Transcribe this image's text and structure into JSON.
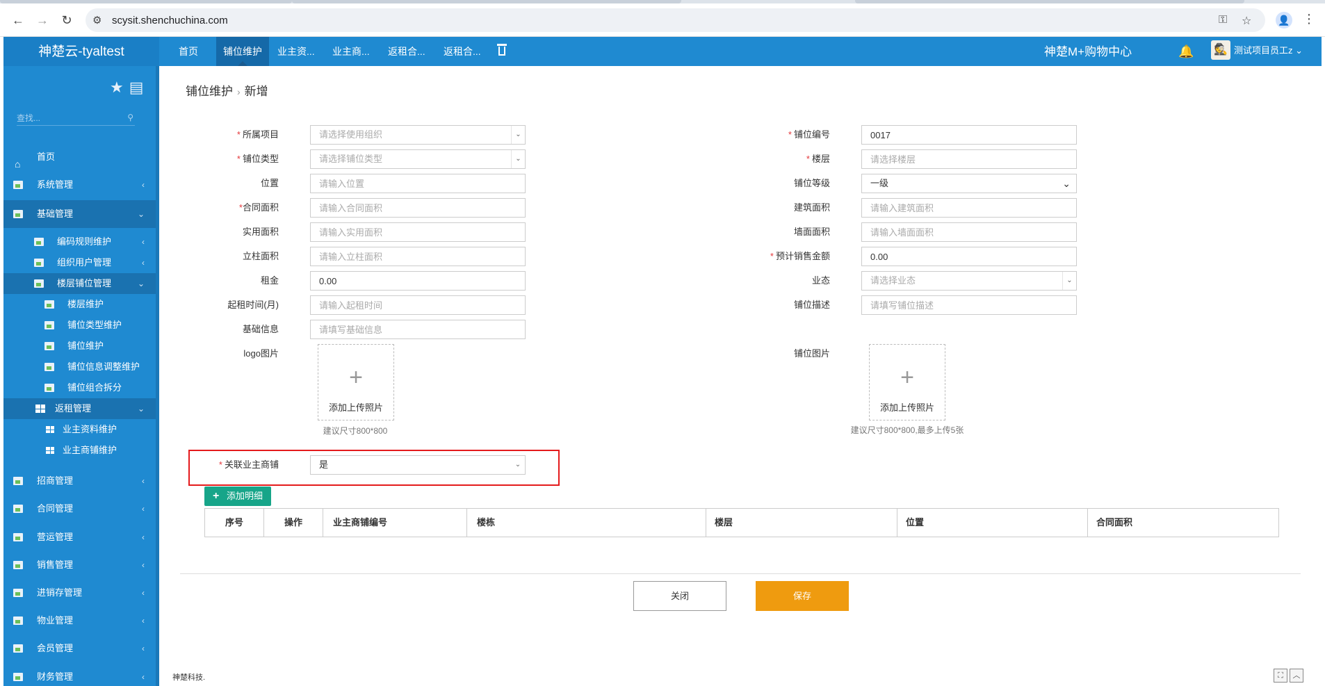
{
  "browser": {
    "url": "scysit.shenchuchina.com",
    "back_icon": "←",
    "forward_icon": "→",
    "reload_icon": "↻",
    "site_icon": "⚙",
    "key_icon": "⚿",
    "star_icon": "☆",
    "profile_icon": "👤",
    "menu_icon": "⋮"
  },
  "header": {
    "brand": "神楚云-tyaltest",
    "tabs": [
      {
        "label": "首页"
      },
      {
        "label": "铺位维护"
      },
      {
        "label": "业主资..."
      },
      {
        "label": "业主商..."
      },
      {
        "label": "返租合..."
      },
      {
        "label": "返租合..."
      }
    ],
    "mall_name": "神楚M+购物中心",
    "user_name": "测试项目员工z ⌄",
    "avatar": "🕵"
  },
  "sidebar": {
    "search_placeholder": "查找...",
    "items": [
      {
        "label": "首页"
      },
      {
        "label": "系统管理"
      },
      {
        "label": "基础管理"
      },
      {
        "label": "编码规则维护"
      },
      {
        "label": "组织用户管理"
      },
      {
        "label": "楼层铺位管理"
      },
      {
        "label": "楼层维护"
      },
      {
        "label": "铺位类型维护"
      },
      {
        "label": "铺位维护"
      },
      {
        "label": "铺位信息调整维护"
      },
      {
        "label": "铺位组合拆分"
      },
      {
        "label": "返租管理"
      },
      {
        "label": "业主资料维护"
      },
      {
        "label": "业主商铺维护"
      },
      {
        "label": "招商管理"
      },
      {
        "label": "合同管理"
      },
      {
        "label": "营运管理"
      },
      {
        "label": "销售管理"
      },
      {
        "label": "进销存管理"
      },
      {
        "label": "物业管理"
      },
      {
        "label": "会员管理"
      },
      {
        "label": "财务管理"
      }
    ]
  },
  "breadcrumb": {
    "parent": "铺位维护",
    "sep": "›",
    "current": "新增"
  },
  "form": {
    "left": {
      "project_label": "所属项目",
      "project_placeholder": "请选择使用组织",
      "type_label": "铺位类型",
      "type_placeholder": "请选择铺位类型",
      "location_label": "位置",
      "location_placeholder": "请输入位置",
      "contract_area_label": "合同面积",
      "contract_area_placeholder": "请输入合同面积",
      "actual_area_label": "实用面积",
      "actual_area_placeholder": "请输入实用面积",
      "pillar_area_label": "立柱面积",
      "pillar_area_placeholder": "请输入立柱面积",
      "rent_label": "租金",
      "rent_value": "0.00",
      "rent_start_label": "起租时间(月)",
      "rent_start_placeholder": "请输入起租时间",
      "basic_info_label": "基础信息",
      "basic_info_placeholder": "请填写基础信息",
      "logo_label": "logo图片"
    },
    "right": {
      "code_label": "铺位编号",
      "code_value": "0017",
      "floor_label": "楼层",
      "floor_placeholder": "请选择楼层",
      "grade_label": "铺位等级",
      "grade_value": "一级",
      "building_area_label": "建筑面积",
      "building_area_placeholder": "请输入建筑面积",
      "wall_area_label": "墙面面积",
      "wall_area_placeholder": "请输入墙面面积",
      "sales_label": "预计销售金额",
      "sales_value": "0.00",
      "format_label": "业态",
      "format_placeholder": "请选择业态",
      "desc_label": "铺位描述",
      "desc_placeholder": "请填写铺位描述",
      "shop_img_label": "铺位图片"
    },
    "upload_label": "添加上传照片",
    "logo_hint": "建议尺寸800*800",
    "shop_img_hint": "建议尺寸800*800,最多上传5张",
    "linked_label": "关联业主商铺",
    "linked_value": "是",
    "required_mark": "*"
  },
  "detail": {
    "add_label": "添加明细",
    "columns": [
      "序号",
      "操作",
      "业主商铺编号",
      "楼栋",
      "楼层",
      "位置",
      "合同面积"
    ]
  },
  "actions": {
    "close": "关闭",
    "save": "保存"
  },
  "footer": {
    "text": "神楚科技."
  }
}
